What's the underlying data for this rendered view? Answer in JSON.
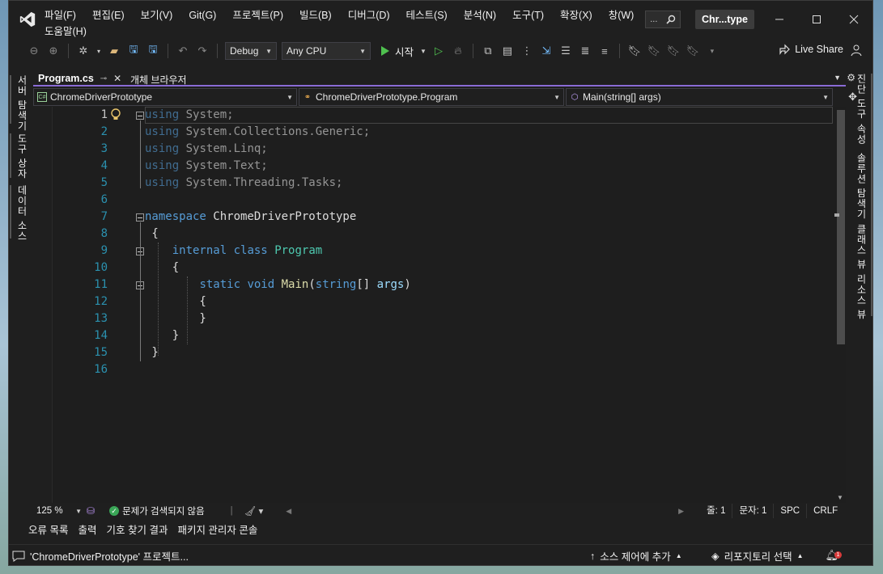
{
  "menu": [
    "파일(F)",
    "편집(E)",
    "보기(V)",
    "Git(G)",
    "프로젝트(P)",
    "빌드(B)",
    "디버그(D)",
    "테스트(S)",
    "분석(N)",
    "도구(T)",
    "확장(X)",
    "창(W)",
    "도움말(H)"
  ],
  "title_search": "...",
  "title_badge": "Chr...type",
  "toolbar": {
    "config": "Debug",
    "platform": "Any CPU",
    "start_label": "시작",
    "live_share": "Live Share"
  },
  "left_rail": [
    "서버 탐색기",
    "도구 상자",
    "데이터 소스"
  ],
  "right_rail": [
    "진단 도구",
    "속성",
    "솔루션 탐색기",
    "클래스 뷰",
    "리소스 뷰"
  ],
  "tabs": {
    "active": "Program.cs",
    "second": "개체 브라우저"
  },
  "navbar": {
    "project": "ChromeDriverPrototype",
    "type": "ChromeDriverPrototype.Program",
    "member": "Main(string[] args)"
  },
  "code_lines": [
    {
      "n": "1",
      "t": "using System;"
    },
    {
      "n": "2",
      "t": "using System.Collections.Generic;"
    },
    {
      "n": "3",
      "t": "using System.Linq;"
    },
    {
      "n": "4",
      "t": "using System.Text;"
    },
    {
      "n": "5",
      "t": "using System.Threading.Tasks;"
    },
    {
      "n": "6",
      "t": ""
    },
    {
      "n": "7",
      "t": "namespace ChromeDriverPrototype"
    },
    {
      "n": "8",
      "t": "{"
    },
    {
      "n": "9",
      "t": "internal class Program"
    },
    {
      "n": "10",
      "t": "{"
    },
    {
      "n": "11",
      "t": "static void Main(string[] args)"
    },
    {
      "n": "12",
      "t": "{"
    },
    {
      "n": "13",
      "t": "}"
    },
    {
      "n": "14",
      "t": "}"
    },
    {
      "n": "15",
      "t": "}"
    },
    {
      "n": "16",
      "t": ""
    }
  ],
  "editor_status": {
    "zoom": "125 %",
    "issues": "문제가 검색되지 않음",
    "line": "줄: 1",
    "col": "문자: 1",
    "whitespace": "SPC",
    "eol": "CRLF"
  },
  "tool_tabs": [
    "오류 목록",
    "출력",
    "기호 찾기 결과",
    "패키지 관리자 콘솔"
  ],
  "statusbar": {
    "message": "'ChromeDriverPrototype' 프로젝트...",
    "source_control": "소스 제어에 추가",
    "repo": "리포지토리 선택",
    "notifications": "1"
  },
  "colors": {
    "accent": "#8a6bd6",
    "keyword": "#569cd6",
    "type": "#4ec9b0",
    "method": "#dcdcaa",
    "line_number": "#2b91af",
    "run_green": "#4fc14f"
  }
}
